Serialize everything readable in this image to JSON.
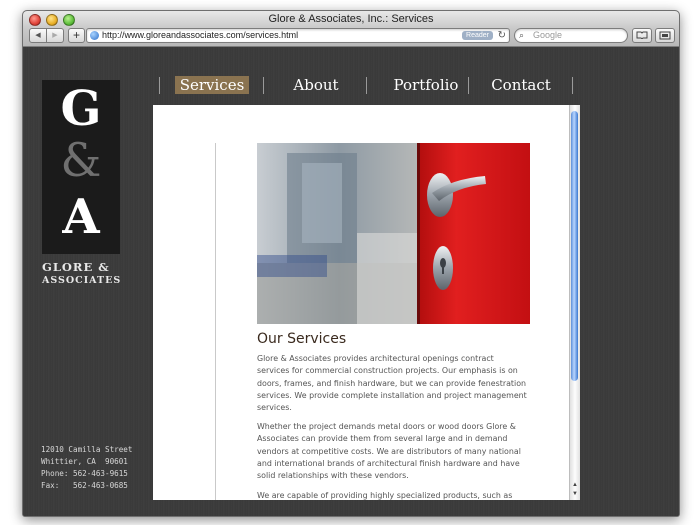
{
  "browser": {
    "window_title": "Glore & Associates, Inc.: Services",
    "url": "http://www.gloreandassociates.com/services.html",
    "reader_label": "Reader",
    "search_placeholder": "Google"
  },
  "site": {
    "logo": {
      "line1": "G",
      "line2": "&",
      "line3": "A"
    },
    "brand_name_line1": "GLORE &",
    "brand_name_line2": "ASSOCIATES",
    "nav": [
      {
        "label": "Services",
        "active": true
      },
      {
        "label": "About"
      },
      {
        "label": "Portfolio"
      },
      {
        "label": "Contact"
      }
    ],
    "address": {
      "street": "12010 Camilla Street",
      "city": "Whittier, CA  90601",
      "phone": "Phone: 562-463-9615",
      "fax": "Fax:   562-463-0685"
    }
  },
  "main": {
    "heading": "Our Services",
    "paragraphs": [
      "Glore & Associates provides architectural openings contract services for commercial construction projects. Our emphasis is on doors, frames, and finish hardware, but we can provide fenestration services. We provide complete installation and project management services.",
      "Whether the project demands metal doors or wood doors Glore & Associates can provide them from several large and in demand vendors at competitive costs. We are distributors of many national and international brands of architectural finish hardware and have solid relationships with these vendors.",
      "We are capable of providing highly specialized products, such as"
    ]
  },
  "colors": {
    "nav_active_bg": "#8a7350",
    "page_bg": "#3b3b3b",
    "door_red": "#d81818",
    "heading_color": "#3a2a1e"
  }
}
